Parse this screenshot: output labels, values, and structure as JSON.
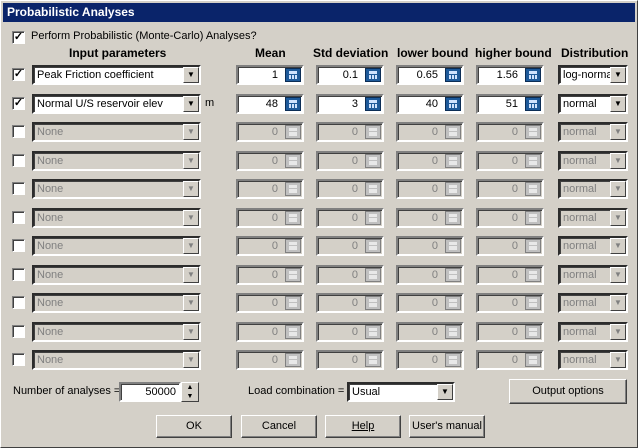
{
  "window": {
    "title": "Probabilistic Analyses"
  },
  "perform_checkbox": {
    "checked": true,
    "label": "Perform Probabilistic (Monte-Carlo) Analyses?"
  },
  "headers": {
    "input": "Input parameters",
    "mean": "Mean",
    "std": "Std deviation",
    "lower": "lower bound",
    "higher": "higher bound",
    "dist": "Distribution"
  },
  "rows": [
    {
      "checked": true,
      "param": "Peak Friction coefficient",
      "unit": "",
      "mean": "1",
      "std": "0.1",
      "lower": "0.65",
      "higher": "1.56",
      "dist": "log-normal"
    },
    {
      "checked": true,
      "param": "Normal U/S reservoir elev",
      "unit": "m",
      "mean": "48",
      "std": "3",
      "lower": "40",
      "higher": "51",
      "dist": "normal"
    },
    {
      "checked": false,
      "param": "None",
      "unit": "",
      "mean": "0",
      "std": "0",
      "lower": "0",
      "higher": "0",
      "dist": "normal"
    },
    {
      "checked": false,
      "param": "None",
      "unit": "",
      "mean": "0",
      "std": "0",
      "lower": "0",
      "higher": "0",
      "dist": "normal"
    },
    {
      "checked": false,
      "param": "None",
      "unit": "",
      "mean": "0",
      "std": "0",
      "lower": "0",
      "higher": "0",
      "dist": "normal"
    },
    {
      "checked": false,
      "param": "None",
      "unit": "",
      "mean": "0",
      "std": "0",
      "lower": "0",
      "higher": "0",
      "dist": "normal"
    },
    {
      "checked": false,
      "param": "None",
      "unit": "",
      "mean": "0",
      "std": "0",
      "lower": "0",
      "higher": "0",
      "dist": "normal"
    },
    {
      "checked": false,
      "param": "None",
      "unit": "",
      "mean": "0",
      "std": "0",
      "lower": "0",
      "higher": "0",
      "dist": "normal"
    },
    {
      "checked": false,
      "param": "None",
      "unit": "",
      "mean": "0",
      "std": "0",
      "lower": "0",
      "higher": "0",
      "dist": "normal"
    },
    {
      "checked": false,
      "param": "None",
      "unit": "",
      "mean": "0",
      "std": "0",
      "lower": "0",
      "higher": "0",
      "dist": "normal"
    },
    {
      "checked": false,
      "param": "None",
      "unit": "",
      "mean": "0",
      "std": "0",
      "lower": "0",
      "higher": "0",
      "dist": "normal"
    }
  ],
  "analyses": {
    "label": "Number of analyses =",
    "value": "50000"
  },
  "load": {
    "label": "Load combination =",
    "value": "Usual"
  },
  "buttons": {
    "output": "Output options",
    "ok": "OK",
    "cancel": "Cancel",
    "help": "Help",
    "manual": "User's manual"
  },
  "icons": {
    "calculator": "calculator-icon",
    "dropdown": "chevron-down-icon",
    "spin": "spinner-icon"
  }
}
